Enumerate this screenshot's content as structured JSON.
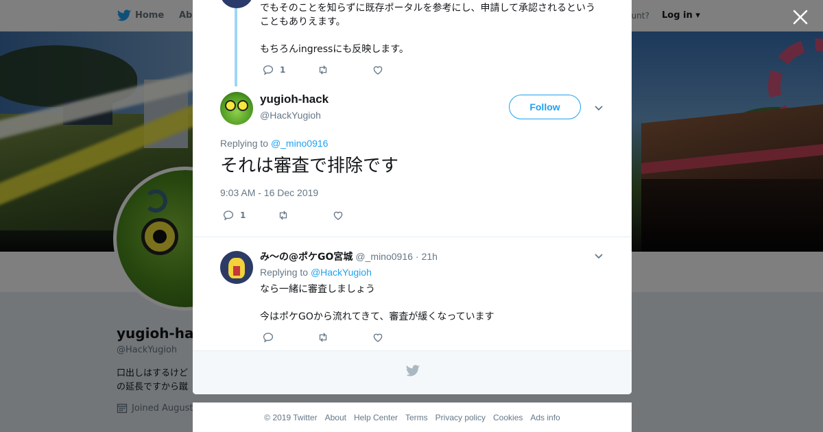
{
  "topbar": {
    "home_label": "Home",
    "about_label": "Abo",
    "account_prompt": "ccount?",
    "login_label": "Log in"
  },
  "profile": {
    "name": "yugioh-hac",
    "handle": "@HackYugioh",
    "bio_line1": "口出しはするけど",
    "bio_line2": "の延長ですから蹴",
    "joined": "Joined August"
  },
  "thread": {
    "previous_tweet": {
      "text": "でもそのことを知らずに既存ポータルを参考にし、申請して承認されるということもありえます。\n\nもちろんingressにも反映します。",
      "reply_count": "1"
    },
    "main_tweet": {
      "name": "yugioh-hack",
      "handle": "@HackYugioh",
      "follow_label": "Follow",
      "replying_prefix": "Replying to",
      "replying_to": "@_mino0916",
      "text": "それは審査で排除です",
      "timestamp": "9:03 AM - 16 Dec 2019",
      "reply_count": "1"
    },
    "reply_tweet": {
      "name": "み〜の@ポケGO宮城",
      "handle": "@_mino0916",
      "separator": "·",
      "time": "21h",
      "replying_prefix": "Replying to",
      "replying_to": "@HackYugioh",
      "text": "なら一緒に審査しましょう\n\n今はポケGOから流れてきて、審査が緩くなっています"
    }
  },
  "footer": {
    "links": [
      "© 2019 Twitter",
      "About",
      "Help Center",
      "Terms",
      "Privacy policy",
      "Cookies",
      "Ads info"
    ]
  },
  "colors": {
    "twitter_blue": "#1da1f2",
    "thread_line": "#a0d6f4",
    "secondary_text": "#657786"
  },
  "icons": [
    "twitter-bird-icon",
    "close-icon",
    "reply-icon",
    "retweet-icon",
    "like-icon",
    "chevron-down-icon",
    "calendar-icon"
  ]
}
